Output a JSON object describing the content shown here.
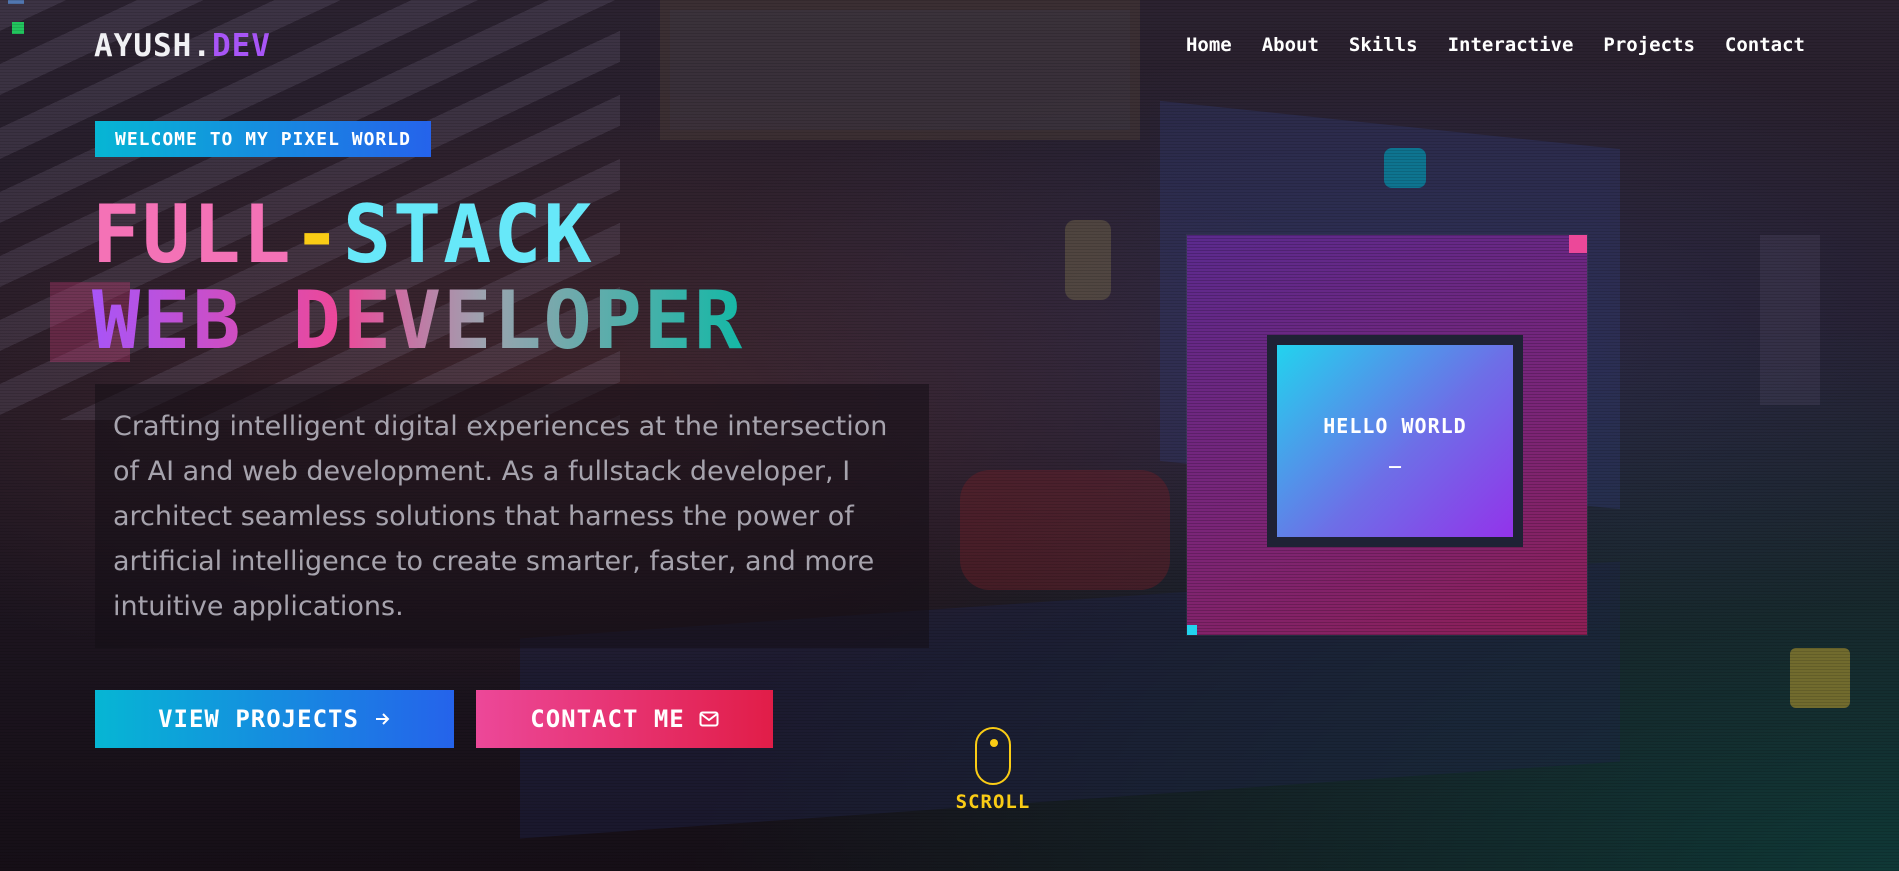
{
  "nav": {
    "logo_main": "AYUSH.",
    "logo_accent": "DEV",
    "links": [
      "Home",
      "About",
      "Skills",
      "Interactive",
      "Projects",
      "Contact"
    ]
  },
  "hero": {
    "badge": "WELCOME TO MY PIXEL WORLD",
    "title_line1_part1": "FULL",
    "title_line1_dash": "-",
    "title_line1_part2": "STACK",
    "title_line2": "WEB DEVELOPER",
    "description": "Crafting intelligent digital experiences at the intersection of AI and web development. As a fullstack developer, I architect seamless solutions that harness the power of artificial intelligence to create smarter, faster, and more intuitive applications.",
    "primary_button": "VIEW PROJECTS",
    "secondary_button": "CONTACT ME"
  },
  "card": {
    "message": "HELLO WORLD",
    "cursor": "_"
  },
  "scroll": {
    "label": "SCROLL"
  },
  "icons": {
    "primary_button": "arrow-right-icon",
    "secondary_button": "mail-icon",
    "scroll": "mouse-icon"
  },
  "colors": {
    "accent_purple": "#a855f7",
    "accent_pink": "#ec4899",
    "accent_cyan": "#06b6d4",
    "accent_blue": "#2563eb",
    "accent_yellow": "#facc15",
    "headline_pink": "#f472b6",
    "headline_cyan": "#67e8f9"
  }
}
